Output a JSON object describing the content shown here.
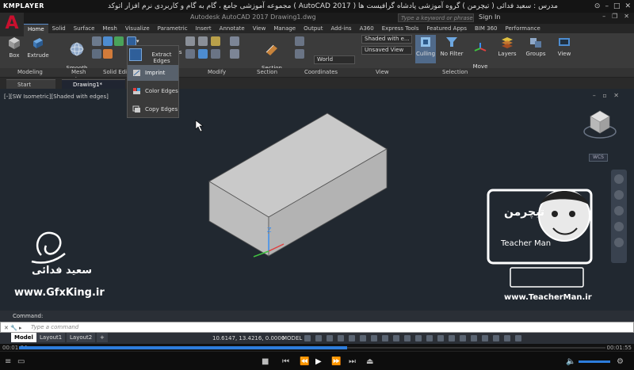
{
  "player": {
    "logo": "KMPLAYER",
    "caption": "مجموعه آموزشی جامع ، گام به گام و کاربردی نرم افزار  اتوکد  ( AutoCAD 2017 )  مدرس : سعید فدائی ( تیچرمن ) گروه آموزشی پادشاه گرافیست ها",
    "time_elapsed": "00:01:04",
    "time_total": "00:01:55",
    "progress": 0.56
  },
  "acad": {
    "doc_title": "Autodesk AutoCAD 2017    Drawing1.dwg",
    "search_placeholder": "Type a keyword or phrase",
    "sign_in": "Sign In"
  },
  "ribbon_tabs": [
    "Home",
    "Solid",
    "Surface",
    "Mesh",
    "Visualize",
    "Parametric",
    "Insert",
    "Annotate",
    "View",
    "Manage",
    "Output",
    "Add-ins",
    "A360",
    "Express Tools",
    "Featured Apps",
    "BIM 360",
    "Performance"
  ],
  "ribbon": {
    "box": "Box",
    "extrude": "Extrude",
    "smooth_object": "Smooth\nObject",
    "extract_edges": "Extract Edges",
    "section_plane": "Section\nPlane",
    "visual_style": "Shaded with e...",
    "view_state": "Unsaved View",
    "ucs": "World",
    "culling": "Culling",
    "no_filter": "No Filter",
    "move_gizmo": "Move\nGizmo",
    "layers": "Layers",
    "groups": "Groups",
    "view": "View",
    "panels": {
      "modeling": "Modeling",
      "mesh": "Mesh",
      "solid_editing": "Solid Edi",
      "modify": "Modify",
      "section": "Section",
      "coordinates": "Coordinates",
      "view": "View",
      "selection": "Selection"
    }
  },
  "dropdown": {
    "items": [
      "Imprint",
      "Color Edges",
      "Copy Edges"
    ]
  },
  "file_tabs": [
    "Start",
    "Drawing1*"
  ],
  "viewport": {
    "label": "[-][SW Isometric][Shaded with edges]",
    "wcs": "WCS",
    "axis_z": "Z"
  },
  "watermarks": {
    "name_fa": "سعید فدائی",
    "url_left": "www.GfxKing.ir",
    "url_right": "www.TeacherMan.ir",
    "brand_fa": "تیچرمن",
    "brand_en": "Teacher Man"
  },
  "command": {
    "history": "Command:",
    "placeholder": "Type a command"
  },
  "status": {
    "layouts": [
      "Model",
      "Layout1",
      "Layout2"
    ],
    "add_layout": "+",
    "coords": "10.6147, 13.4216, 0.0000",
    "model": "MODEL"
  },
  "colors": {
    "drawing_bg": "#212830",
    "box_top": "#c9c9c9",
    "box_front": "#bdbdbd",
    "box_right": "#a8a8a8",
    "accent": "#2d7ddc"
  }
}
